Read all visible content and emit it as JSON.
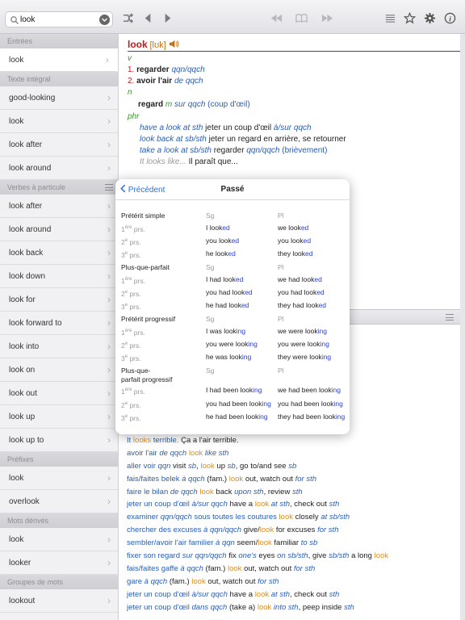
{
  "search": {
    "value": "look"
  },
  "sidebar": {
    "sections": [
      {
        "title": "Entrées",
        "items": [
          "look"
        ]
      },
      {
        "title": "Texte intégral",
        "items": [
          "good-looking",
          "look",
          "look after",
          "look around"
        ]
      },
      {
        "title": "Verbes à particule",
        "items": [
          "look after",
          "look around",
          "look back",
          "look down",
          "look for",
          "look forward to",
          "look into",
          "look on",
          "look out",
          "look up",
          "look up to"
        ]
      },
      {
        "title": "Préfixes",
        "items": [
          "look",
          "overlook"
        ]
      },
      {
        "title": "Mots dérivés",
        "items": [
          "look",
          "looker"
        ]
      },
      {
        "title": "Groupes de mots",
        "items": [
          "lookout"
        ]
      }
    ]
  },
  "entry": {
    "headword": "look",
    "phonetic": "[lʊk]",
    "pos_v": "v",
    "n1": "1.",
    "w1": "regarder",
    "w1_obj": "qqn/qqch",
    "n2": "2.",
    "w2": "avoir l'air",
    "w2_obj": "de qqch",
    "pos_n": "n",
    "noun": "regard",
    "noun_g": "m",
    "noun_sur": "sur qqch",
    "noun_gloss": "(coup d'œil)",
    "pos_phr": "phr",
    "p1_en": "have a look at sth",
    "p1_fr": "jeter un coup d'œil",
    "p1_obj": "à/sur qqch",
    "p2_en": "look back at sb/sth",
    "p2_fr": "jeter un regard en arrière, se retourner",
    "p3_en": "take a look at sb/sth",
    "p3_fr": "regarder",
    "p3_obj": "qqn/qqch",
    "p3_gloss": "(brièvement)",
    "p4_en": "It looks like...",
    "p4_fr": "Il paraît que..."
  },
  "popup": {
    "back": "Précédent",
    "title": "Passé",
    "sg": "Sg",
    "pl": "Pl",
    "p1": "1",
    "p2": "2",
    "p3": "3",
    "sup1": "ère",
    "sup": "e",
    "prs": "prs.",
    "tenses": [
      {
        "name": "Prétérit simple",
        "rows": [
          [
            "I look",
            "ed",
            "we look",
            "ed"
          ],
          [
            "you look",
            "ed",
            "you look",
            "ed"
          ],
          [
            "he look",
            "ed",
            "they look",
            "ed"
          ]
        ]
      },
      {
        "name": "Plus-que-parfait",
        "rows": [
          [
            "I had look",
            "ed",
            "we had look",
            "ed"
          ],
          [
            "you had look",
            "ed",
            "you had look",
            "ed"
          ],
          [
            "he had look",
            "ed",
            "they had look",
            "ed"
          ]
        ]
      },
      {
        "name": "Prétérit progressif",
        "rows": [
          [
            "I was look",
            "ing",
            "we were look",
            "ing"
          ],
          [
            "you were look",
            "ing",
            "you were look",
            "ing"
          ],
          [
            "he was look",
            "ing",
            "they were look",
            "ing"
          ]
        ]
      },
      {
        "name": "Plus-que-\nparfait progressif",
        "rows": [
          [
            "I had been look",
            "ing",
            "we had been look",
            "ing"
          ],
          [
            "you had been look",
            "ing",
            "you had been look",
            "ing"
          ],
          [
            "he had been look",
            "ing",
            "they had been look",
            "ing"
          ]
        ]
      }
    ]
  },
  "phrases": [
    [
      [
        "It ",
        "blue"
      ],
      [
        "looks",
        "orange"
      ],
      [
        " terrible.",
        "blue"
      ],
      [
        "  Ça a l'air terrible.",
        ""
      ]
    ],
    [
      [
        "avoir l'air ",
        "blue"
      ],
      [
        "de qqch",
        "blueit"
      ],
      [
        "  ",
        ""
      ],
      [
        "look",
        "orange"
      ],
      [
        " like sth",
        "blueit"
      ]
    ],
    [
      [
        "aller voir ",
        "blue"
      ],
      [
        "qqn",
        "blueit"
      ],
      [
        "  visit ",
        ""
      ],
      [
        "sb",
        "blueit"
      ],
      [
        ", ",
        ""
      ],
      [
        "look",
        "orange"
      ],
      [
        " up ",
        ""
      ],
      [
        "sb",
        "blueit"
      ],
      [
        ", go to/and see ",
        ""
      ],
      [
        "sb",
        "blueit"
      ]
    ],
    [
      [
        "fais/faites belek ",
        "blue"
      ],
      [
        "à qqch",
        "blueit"
      ],
      [
        " (fam.)  ",
        ""
      ],
      [
        "look",
        "orange"
      ],
      [
        " out, watch out ",
        ""
      ],
      [
        "for sth",
        "blueit"
      ]
    ],
    [
      [
        "faire le bilan ",
        "blue"
      ],
      [
        "de qqch",
        "blueit"
      ],
      [
        "  ",
        ""
      ],
      [
        "look",
        "orange"
      ],
      [
        " back ",
        ""
      ],
      [
        "upon sth",
        "blueit"
      ],
      [
        ", review ",
        ""
      ],
      [
        "sth",
        "blueit"
      ]
    ],
    [
      [
        "jeter un coup d'œil ",
        "blue"
      ],
      [
        "à/sur qqch",
        "blueit"
      ],
      [
        "  have a ",
        ""
      ],
      [
        "look",
        "orange"
      ],
      [
        " ",
        ""
      ],
      [
        "at sth",
        "blueit"
      ],
      [
        ", check out ",
        ""
      ],
      [
        "sth",
        "blueit"
      ]
    ],
    [
      [
        "examiner ",
        "blue"
      ],
      [
        "qqn/qqch",
        "blueit"
      ],
      [
        " sous toutes les coutures",
        "blue"
      ],
      [
        "  ",
        ""
      ],
      [
        "look",
        "orange"
      ],
      [
        " closely ",
        ""
      ],
      [
        "at sb/sth",
        "blueit"
      ]
    ],
    [
      [
        "chercher des excuses ",
        "blue"
      ],
      [
        "à qqn/qqch",
        "blueit"
      ],
      [
        "  give/",
        ""
      ],
      [
        "look",
        "orange"
      ],
      [
        " for excuses ",
        ""
      ],
      [
        "for sth",
        "blueit"
      ]
    ],
    [
      [
        "sembler/avoir l'air familier ",
        "blue"
      ],
      [
        "à qqn",
        "blueit"
      ],
      [
        "  seem/",
        ""
      ],
      [
        "look",
        "orange"
      ],
      [
        " familiar ",
        ""
      ],
      [
        "to sb",
        "blueit"
      ]
    ],
    [
      [
        "fixer son regard ",
        "blue"
      ],
      [
        "sur qqn/qqch",
        "blueit"
      ],
      [
        "  fix ",
        ""
      ],
      [
        "one's",
        "blueit"
      ],
      [
        " eyes ",
        ""
      ],
      [
        "on sb/sth",
        "blueit"
      ],
      [
        ", give ",
        ""
      ],
      [
        "sb/sth",
        "blueit"
      ],
      [
        " a long ",
        ""
      ],
      [
        "look",
        "orange"
      ]
    ],
    [
      [
        "fais/faites gaffe ",
        "blue"
      ],
      [
        "à qqch",
        "blueit"
      ],
      [
        " (fam.)  ",
        ""
      ],
      [
        "look",
        "orange"
      ],
      [
        " out, watch out ",
        ""
      ],
      [
        "for sth",
        "blueit"
      ]
    ],
    [
      [
        "gare ",
        "blue"
      ],
      [
        "à qqch",
        "blueit"
      ],
      [
        " (fam.)  ",
        ""
      ],
      [
        "look",
        "orange"
      ],
      [
        " out, watch out ",
        ""
      ],
      [
        "for sth",
        "blueit"
      ]
    ],
    [
      [
        "jeter un coup d'œil ",
        "blue"
      ],
      [
        "à/sur qqch",
        "blueit"
      ],
      [
        "  have a ",
        ""
      ],
      [
        "look",
        "orange"
      ],
      [
        " ",
        ""
      ],
      [
        "at sth",
        "blueit"
      ],
      [
        ", check out ",
        ""
      ],
      [
        "sth",
        "blueit"
      ]
    ],
    [
      [
        "jeter un coup d'œil ",
        "blue"
      ],
      [
        "dans qqch",
        "blueit"
      ],
      [
        "  (take a) ",
        ""
      ],
      [
        "look",
        "orange"
      ],
      [
        " ",
        ""
      ],
      [
        "into sth",
        "blueit"
      ],
      [
        ", peep inside ",
        ""
      ],
      [
        "sth",
        "blueit"
      ]
    ]
  ]
}
